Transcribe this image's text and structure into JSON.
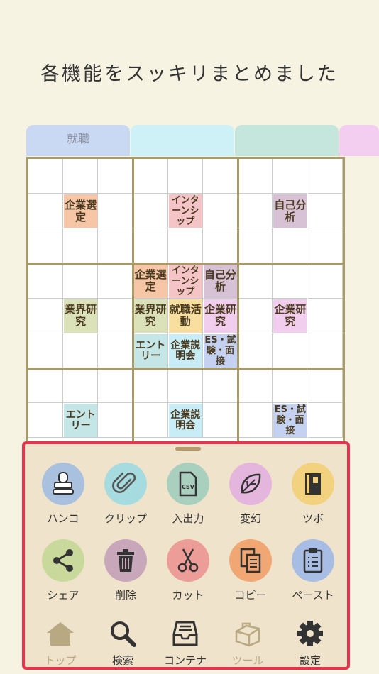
{
  "headline": "各機能をスッキリまとめました",
  "tabs": [
    {
      "label": "就職",
      "color": "#c9d9f3"
    },
    {
      "label": "",
      "color": "#cdf1f6"
    },
    {
      "label": "",
      "color": "#c5e6dc"
    },
    {
      "label": "",
      "color": "#f3cef0"
    }
  ],
  "grid_tags": [
    {
      "row": 1,
      "col": 1,
      "label": "企業選定",
      "color": "#f6c6a6"
    },
    {
      "row": 1,
      "col": 4,
      "label": "インターンシップ",
      "color": "#f4c4c6"
    },
    {
      "row": 1,
      "col": 7,
      "label": "自己分析",
      "color": "#d6c2d4"
    },
    {
      "row": 3,
      "col": 3,
      "label": "企業選定",
      "color": "#f6c6a6"
    },
    {
      "row": 3,
      "col": 4,
      "label": "インターンシップ",
      "color": "#f4c4c6"
    },
    {
      "row": 3,
      "col": 5,
      "label": "自己分析",
      "color": "#d6c2d4"
    },
    {
      "row": 4,
      "col": 1,
      "label": "業界研究",
      "color": "#dbe1b9"
    },
    {
      "row": 4,
      "col": 3,
      "label": "業界研究",
      "color": "#dbe1b9"
    },
    {
      "row": 4,
      "col": 4,
      "label": "就職活動",
      "color": "#f8dfa0"
    },
    {
      "row": 4,
      "col": 5,
      "label": "企業研究",
      "color": "#f1cdee"
    },
    {
      "row": 4,
      "col": 7,
      "label": "企業研究",
      "color": "#f1cdee"
    },
    {
      "row": 5,
      "col": 3,
      "label": "エントリー",
      "color": "#c4e6e6"
    },
    {
      "row": 5,
      "col": 4,
      "label": "企業説明会",
      "color": "#c8edf6"
    },
    {
      "row": 5,
      "col": 5,
      "label": "ES・試験・面接",
      "color": "#c4d1f0"
    },
    {
      "row": 7,
      "col": 1,
      "label": "エントリー",
      "color": "#c4e6e6"
    },
    {
      "row": 7,
      "col": 4,
      "label": "企業説明会",
      "color": "#c8edf6"
    },
    {
      "row": 7,
      "col": 7,
      "label": "ES・試験・面接",
      "color": "#c4d1f0"
    }
  ],
  "tools": [
    {
      "label": "ハンコ",
      "icon": "stamp-icon",
      "color": "#a9c0de"
    },
    {
      "label": "クリップ",
      "icon": "paperclip-icon",
      "color": "#a6dcdf"
    },
    {
      "label": "入出力",
      "icon": "csv-file-icon",
      "color": "#a9cfbf"
    },
    {
      "label": "変幻",
      "icon": "leaf-icon",
      "color": "#e4b6de"
    },
    {
      "label": "ツボ",
      "icon": "book-icon",
      "color": "#f2d17f"
    },
    {
      "label": "シェア",
      "icon": "share-icon",
      "color": "#c9d99b"
    },
    {
      "label": "削除",
      "icon": "trash-icon",
      "color": "#c8a7bb"
    },
    {
      "label": "カット",
      "icon": "scissors-icon",
      "color": "#ed9d97"
    },
    {
      "label": "コピー",
      "icon": "copy-icon",
      "color": "#f0a774"
    },
    {
      "label": "ペースト",
      "icon": "clipboard-icon",
      "color": "#a8bde3"
    }
  ],
  "nav": [
    {
      "label": "トップ",
      "icon": "home-icon",
      "active": true
    },
    {
      "label": "検索",
      "icon": "search-icon",
      "active": false
    },
    {
      "label": "コンテナ",
      "icon": "tray-icon",
      "active": false
    },
    {
      "label": "ツール",
      "icon": "toolbox-icon",
      "active": false
    },
    {
      "label": "設定",
      "icon": "gear-icon",
      "active": false
    }
  ],
  "colors": {
    "panel_border": "#e8334f",
    "grid_line": "#a99a6a",
    "background": "#f6f3e2",
    "nav_inactive": "#b9a983"
  }
}
